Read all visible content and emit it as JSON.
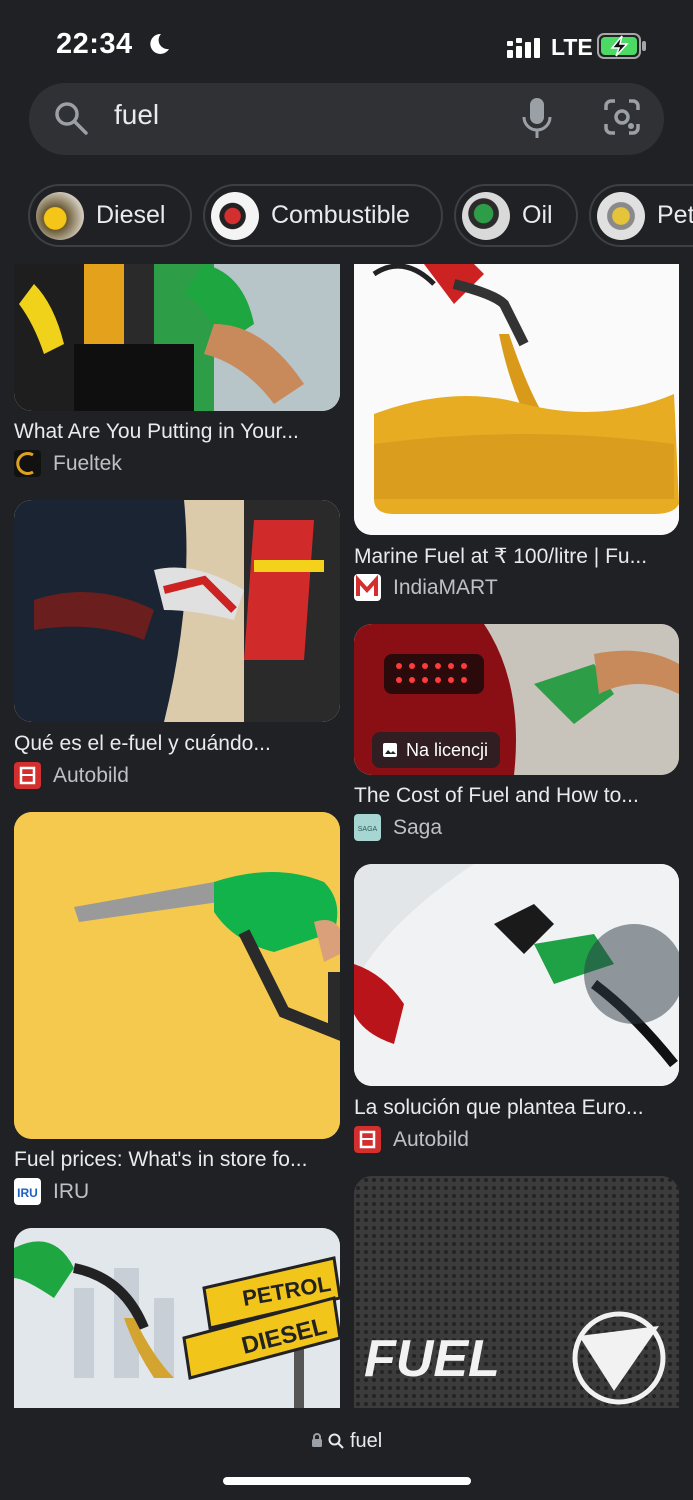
{
  "status_bar": {
    "time": "22:34",
    "network": "LTE",
    "do_not_disturb_icon": "moon-icon",
    "battery": "charging"
  },
  "search": {
    "query": "fuel",
    "icons": [
      "search-icon",
      "mic-icon",
      "lens-icon"
    ]
  },
  "chips": [
    {
      "label": "Diesel"
    },
    {
      "label": "Combustible"
    },
    {
      "label": "Oil"
    },
    {
      "label": "Pet"
    }
  ],
  "results": [
    {
      "title": "What Are You Putting in Your...",
      "source": "Fueltek"
    },
    {
      "title": "Marine Fuel at ₹ 100/litre | Fu...",
      "source": "IndiaMART"
    },
    {
      "title": "Qué es el e-fuel y cuándo...",
      "source": "Autobild"
    },
    {
      "title": "The Cost of Fuel and How to...",
      "source": "Saga",
      "badge": "Na licencji",
      "favicon_text": "SAGA"
    },
    {
      "title": "Fuel prices: What's in store fo...",
      "source": "IRU",
      "favicon_text": "IRU"
    },
    {
      "title": "La solución que plantea Euro...",
      "source": "Autobild"
    },
    {
      "sign_top": "PETROL",
      "sign_bottom": "DIESEL"
    },
    {
      "logo_text": "FUEL"
    }
  ],
  "bottom_bar": {
    "url": "fuel"
  },
  "colors": {
    "background": "#202124",
    "search_bg": "#303134",
    "chip_border": "#3c4043",
    "text": "#e8eaed",
    "muted": "#bdc1c6"
  }
}
